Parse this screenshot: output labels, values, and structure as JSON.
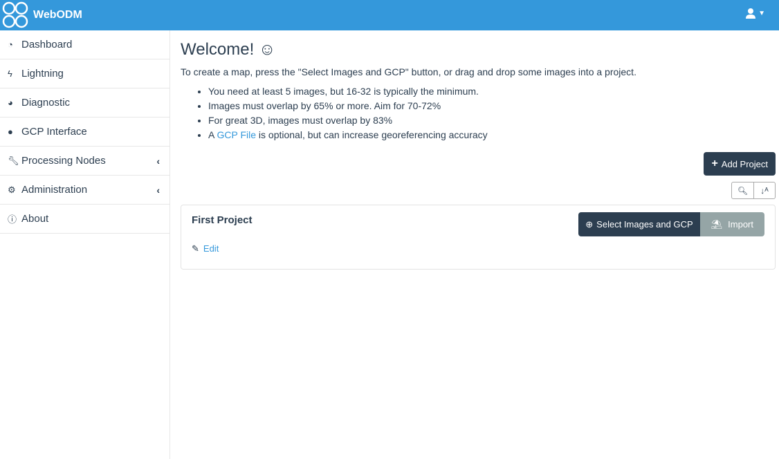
{
  "header": {
    "brand": "WebODM",
    "user_icon": "user-icon"
  },
  "sidebar": {
    "items": [
      {
        "label": "Dashboard",
        "icon": "tachometer-icon"
      },
      {
        "label": "Lightning",
        "icon": "bolt-icon"
      },
      {
        "label": "Diagnostic",
        "icon": "pie-chart-icon"
      },
      {
        "label": "GCP Interface",
        "icon": "map-marker-icon"
      },
      {
        "label": "Processing Nodes",
        "icon": "wrench-icon"
      },
      {
        "label": "Administration",
        "icon": "cogs-icon"
      },
      {
        "label": "About",
        "icon": "info-circle-icon"
      }
    ]
  },
  "main": {
    "title": "Welcome! ☺",
    "intro": "To create a map, press the \"Select Images and GCP\" button, or drag and drop some images into a project.",
    "tips": [
      "You need at least 5 images, but 16-32 is typically the minimum.",
      "Images must overlap by 65% or more. Aim for 70-72%",
      "For great 3D, images must overlap by 83%"
    ],
    "tip4_prefix": "A ",
    "tip4_link": "GCP File",
    "tip4_suffix": " is optional, but can increase georeferencing accuracy",
    "add_project": "Add Project",
    "project": {
      "name": "First Project",
      "edit": "Edit",
      "select": "Select Images and GCP",
      "import": "Import"
    }
  }
}
